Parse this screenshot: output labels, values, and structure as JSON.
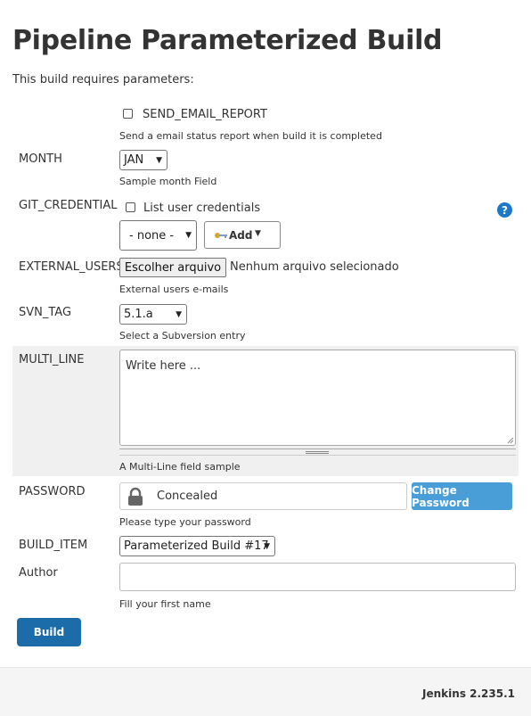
{
  "page": {
    "title": "Pipeline Parameterized Build",
    "intro": "This build requires parameters:"
  },
  "params": {
    "send_email": {
      "label": "SEND_EMAIL_REPORT",
      "description": "Send a email status report when build it is completed",
      "checked": false
    },
    "month": {
      "label": "MONTH",
      "selected": "JAN",
      "description": "Sample month Field"
    },
    "git_credential": {
      "label": "GIT_CREDENTIAL",
      "list_user_credentials_label": "List user credentials",
      "selected": "- none -",
      "add_label": "Add",
      "help": "?"
    },
    "external_users": {
      "label": "EXTERNAL_USERS",
      "choose_file_label": "Escolher arquivo",
      "no_file_label": "Nenhum arquivo selecionado",
      "description": "External users e-mails"
    },
    "svn_tag": {
      "label": "SVN_TAG",
      "selected": "5.1.a",
      "description": "Select a Subversion entry"
    },
    "multi_line": {
      "label": "MULTI_LINE",
      "value": "Write here ...",
      "description": "A Multi-Line field sample"
    },
    "password": {
      "label": "PASSWORD",
      "value": "Concealed",
      "change_label": "Change Password",
      "description": "Please type your password"
    },
    "build_item": {
      "label": "BUILD_ITEM",
      "selected": "Parameterized Build #17"
    },
    "author": {
      "label": "Author",
      "value": "",
      "description": "Fill your first name"
    }
  },
  "actions": {
    "build_label": "Build"
  },
  "footer": {
    "version": "Jenkins 2.235.1"
  },
  "colors": {
    "primary": "#1b6ca8",
    "secondary_button": "#4a9ed8",
    "help_icon": "#1e78c8"
  }
}
